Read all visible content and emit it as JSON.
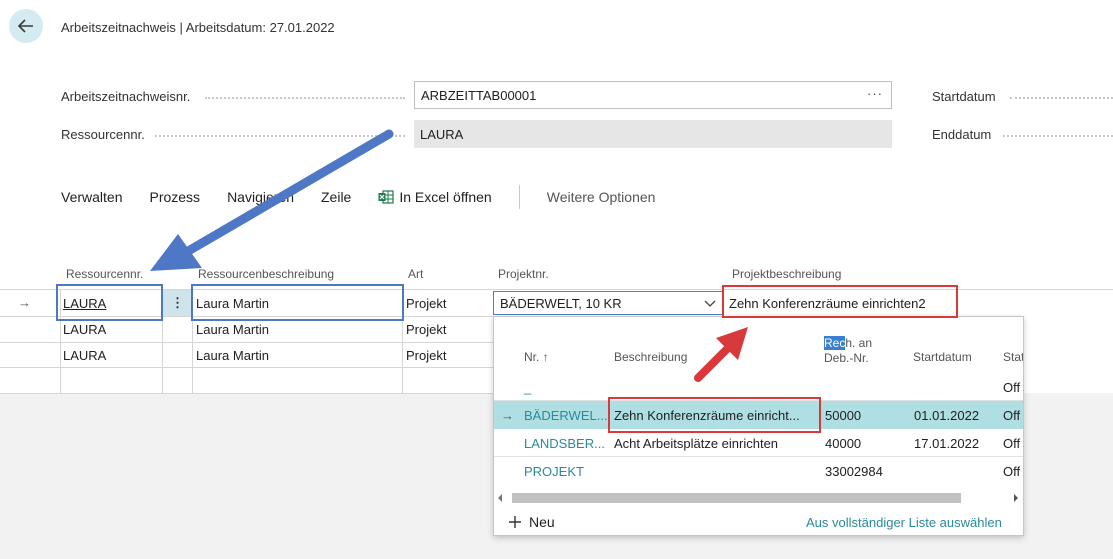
{
  "header": {
    "title": "Arbeitszeitnachweis | Arbeitsdatum: 27.01.2022"
  },
  "form": {
    "fields": [
      {
        "label": "Arbeitszeitnachweisnr.",
        "value": "ARBZEITTAB00001",
        "assist": "···"
      },
      {
        "label": "Ressourcennr.",
        "value": "LAURA"
      }
    ],
    "right_labels": [
      "Startdatum",
      "Enddatum"
    ]
  },
  "actions": {
    "items": [
      "Verwalten",
      "Prozess",
      "Navigieren",
      "Zeile",
      "In Excel öffnen"
    ],
    "more": "Weitere Optionen"
  },
  "lines": {
    "columns": [
      "Ressourcennr.",
      "Ressourcenbeschreibung",
      "Art",
      "Projektnr.",
      "Projektbeschreibung"
    ],
    "rows": [
      {
        "resource": "LAURA",
        "description": "Laura Martin",
        "type": "Projekt",
        "project": "BÄDERWELT, 10 KR",
        "project_desc": "Zehn Konferenzräume einrichten2"
      },
      {
        "resource": "LAURA",
        "description": "Laura Martin",
        "type": "Projekt"
      },
      {
        "resource": "LAURA",
        "description": "Laura Martin",
        "type": "Projekt"
      }
    ],
    "row_menu": "⋮",
    "row_indicator": "→"
  },
  "lookup": {
    "columns": {
      "nr": "Nr. ↑",
      "desc": "Beschreibung",
      "deb_line1": "Rech. an",
      "deb_line2": "Deb.-Nr.",
      "start": "Startdatum",
      "status": "Stat"
    },
    "rows": [
      {
        "nr": "_",
        "desc": "",
        "deb": "",
        "start": "",
        "status": "Off"
      },
      {
        "nr": "BÄDERWEL...",
        "desc": "Zehn Konferenzräume einricht...",
        "deb": "50000",
        "start": "01.01.2022",
        "status": "Off"
      },
      {
        "nr": "LANDSBER...",
        "desc": "Acht Arbeitsplätze einrichten",
        "deb": "40000",
        "start": "17.01.2022",
        "status": "Off"
      },
      {
        "nr": "PROJEKT",
        "desc": "",
        "deb": "33002984",
        "start": "",
        "status": "Off"
      }
    ],
    "new_label": "Neu",
    "full_list_link": "Aus vollständiger Liste auswählen"
  },
  "colors": {
    "annotation_blue": "#4e77c5",
    "annotation_red": "#d8393b",
    "link_teal": "#2a8a9a",
    "selected_row": "#b0dfe3"
  },
  "icons": [
    "back-arrow-icon",
    "excel-icon",
    "chevron-down-icon",
    "row-arrow-icon",
    "plus-icon",
    "scroll-left-icon",
    "scroll-right-icon"
  ]
}
